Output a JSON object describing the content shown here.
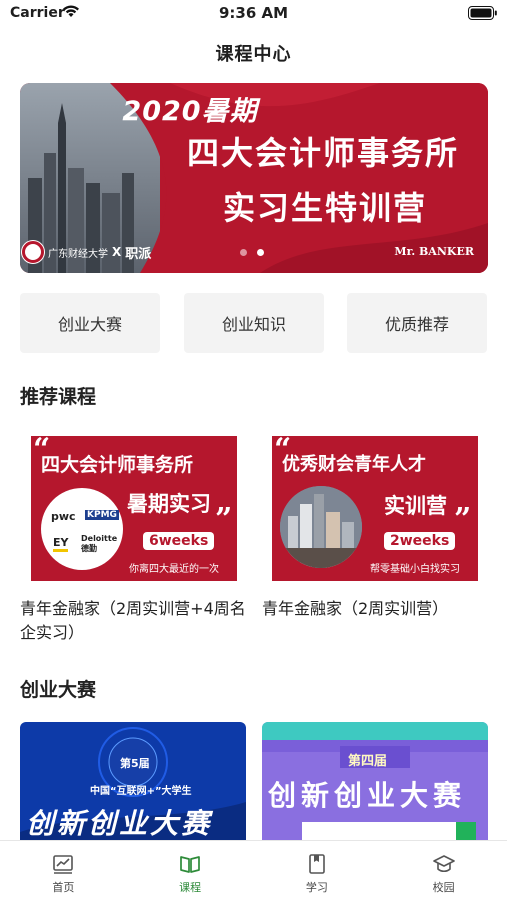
{
  "status": {
    "carrier": "Carrier",
    "time": "9:36 AM"
  },
  "nav": {
    "title": "课程中心"
  },
  "banner": {
    "year": "2020暑期",
    "line1": "四大会计师事务所",
    "line2": "实习生特训营",
    "partner_school": "广东财经大学",
    "partner_x": "X",
    "partner_platform": "职派",
    "brand": "Mr. BANKER",
    "dots": 2,
    "active_dot": 1
  },
  "categories": [
    {
      "label": "创业大赛"
    },
    {
      "label": "创业知识"
    },
    {
      "label": "优质推荐"
    }
  ],
  "recommended": {
    "title": "推荐课程",
    "courses": [
      {
        "thumb_title": "四大会计师事务所",
        "thumb_sub": "暑期实习",
        "weeks": "6weeks",
        "note": "你离四大最近的一次",
        "logos": [
          "pwc",
          "KPMG",
          "EY",
          "Deloitte 德勤"
        ],
        "name": "青年金融家（2周实训营+4周名企实习）"
      },
      {
        "thumb_title": "优秀财会青年人才",
        "thumb_sub": "实训营",
        "weeks": "2weeks",
        "note": "帮零基础小白找实习",
        "name": "青年金融家（2周实训营）"
      }
    ]
  },
  "competition": {
    "title": "创业大赛",
    "cards": [
      {
        "badge": "第5届",
        "subtitle": "中国“互联网+”大学生",
        "title": "创新创业大赛"
      },
      {
        "badge": "第四届",
        "title": "创新创业大赛"
      }
    ]
  },
  "tabs": [
    {
      "label": "首页",
      "icon": "chart-icon",
      "active": false
    },
    {
      "label": "课程",
      "icon": "book-icon",
      "active": true
    },
    {
      "label": "学习",
      "icon": "notebook-icon",
      "active": false
    },
    {
      "label": "校园",
      "icon": "graduation-cap-icon",
      "active": false
    }
  ],
  "colors": {
    "brand_red": "#b5172d",
    "tab_active": "#2e8b3a",
    "button_bg": "#f3f3f3"
  }
}
